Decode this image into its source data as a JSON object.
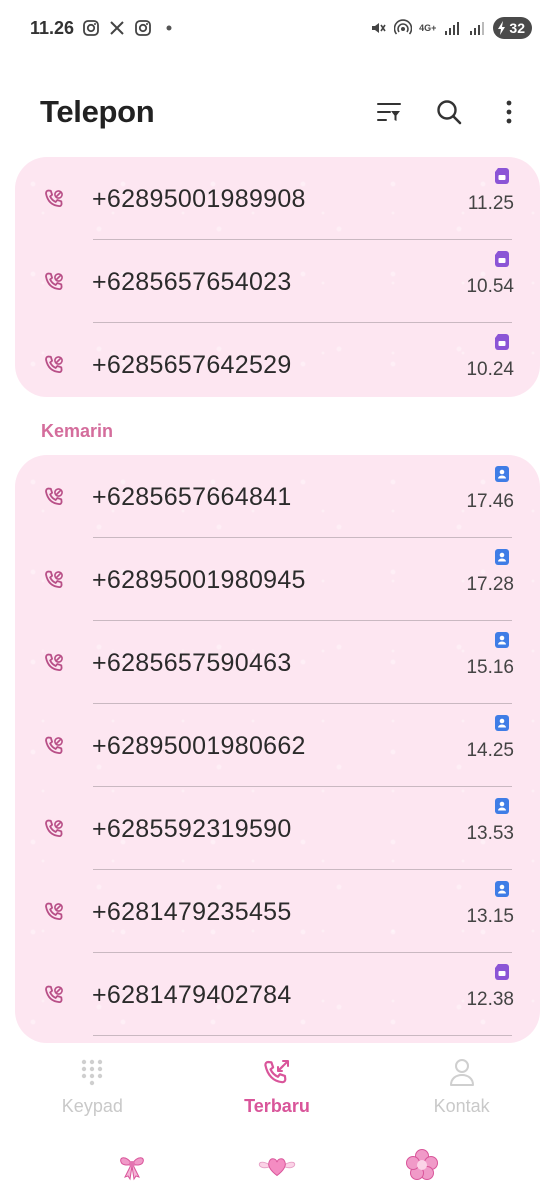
{
  "status": {
    "time": "11.26",
    "network": "4G+",
    "battery": "32"
  },
  "header": {
    "title": "Telepon"
  },
  "today_calls": [
    {
      "number": "+62895001989908",
      "time": "11.25",
      "sim_color": "#8b55d6"
    },
    {
      "number": "+6285657654023",
      "time": "10.54",
      "sim_color": "#8b55d6"
    },
    {
      "number": "+6285657642529",
      "time": "10.24",
      "sim_color": "#8b55d6"
    }
  ],
  "yesterday": {
    "label": "Kemarin",
    "calls": [
      {
        "number": "+6285657664841",
        "time": "17.46",
        "sim_color": "#3f7de6"
      },
      {
        "number": "+62895001980945",
        "time": "17.28",
        "sim_color": "#3f7de6"
      },
      {
        "number": "+6285657590463",
        "time": "15.16",
        "sim_color": "#3f7de6"
      },
      {
        "number": "+62895001980662",
        "time": "14.25",
        "sim_color": "#3f7de6"
      },
      {
        "number": "+6285592319590",
        "time": "13.53",
        "sim_color": "#3f7de6"
      },
      {
        "number": "+6281479235455",
        "time": "13.15",
        "sim_color": "#3f7de6"
      },
      {
        "number": "+6281479402784",
        "time": "12.38",
        "sim_color": "#8b55d6"
      }
    ]
  },
  "nav": {
    "keypad": "Keypad",
    "recents": "Terbaru",
    "contacts": "Kontak"
  },
  "colors": {
    "accent": "#d9559a",
    "card_bg": "#fde6f1",
    "section_label": "#d46d9c"
  }
}
